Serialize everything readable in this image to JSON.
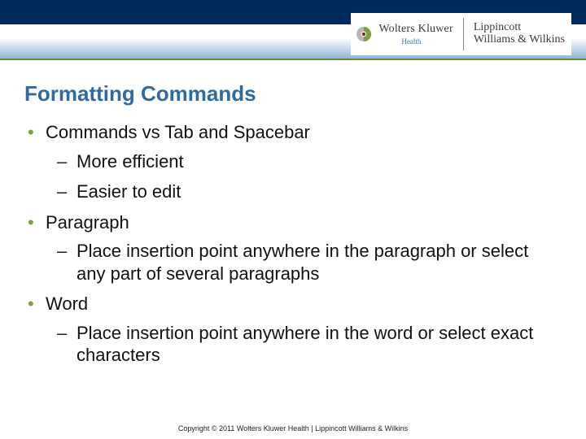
{
  "header": {
    "brand1_name": "Wolters Kluwer",
    "brand1_sub": "Health",
    "brand2_line1": "Lippincott",
    "brand2_line2": "Williams & Wilkins"
  },
  "slide": {
    "title": "Formatting Commands",
    "bullets": [
      {
        "text": "Commands vs Tab and Spacebar",
        "sub": [
          "More efficient",
          "Easier to edit"
        ]
      },
      {
        "text": "Paragraph",
        "sub": [
          "Place insertion point anywhere in the paragraph or select any part of several paragraphs"
        ]
      },
      {
        "text": "Word",
        "sub": [
          "Place insertion point anywhere in the word or select exact characters"
        ]
      }
    ]
  },
  "footer": {
    "copyright": "Copyright © 2011 Wolters Kluwer Health | Lippincott Williams & Wilkins"
  }
}
